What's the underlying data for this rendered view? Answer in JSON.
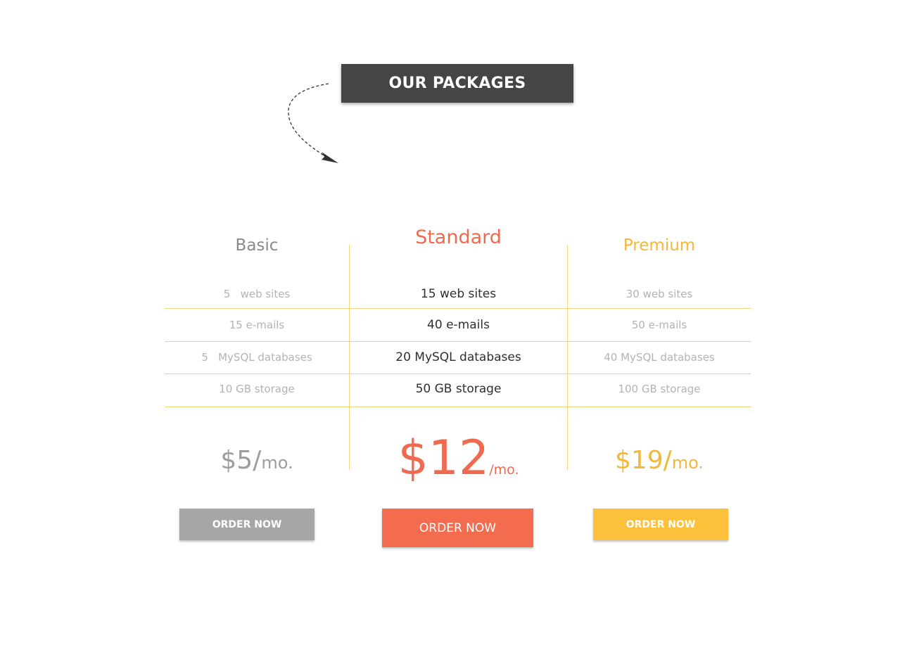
{
  "header": {
    "title": "OUR PACKAGES"
  },
  "colors": {
    "banner_bg": "#454545",
    "basic": "#a6a6a6",
    "standard": "#f36c50",
    "premium": "#fdc03a",
    "divider": "#f6d47e"
  },
  "icons": {
    "arrow": "curved-dashed-arrow-icon"
  },
  "plans": [
    {
      "name": "Basic",
      "features": [
        "5   web sites",
        "15 e-mails",
        "5   MySQL databases",
        "10 GB storage"
      ],
      "price_amount": "$5/",
      "price_period": "mo.",
      "button_label": "ORDER NOW"
    },
    {
      "name": "Standard",
      "features": [
        "15 web sites",
        "40 e-mails",
        "20 MySQL databases",
        "50 GB storage"
      ],
      "price_amount": "$12",
      "price_period": "/mo.",
      "button_label": "ORDER NOW"
    },
    {
      "name": "Premium",
      "features": [
        "30 web sites",
        "50 e-mails",
        "40 MySQL databases",
        "100 GB storage"
      ],
      "price_amount": "$19/",
      "price_period": "mo.",
      "button_label": "ORDER NOW"
    }
  ]
}
